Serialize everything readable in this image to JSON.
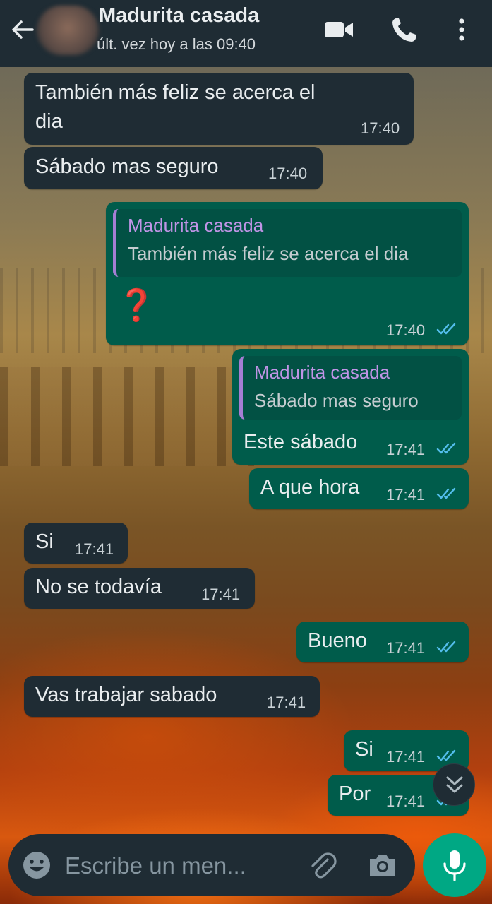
{
  "header": {
    "contact_name": "Madurita casada",
    "last_seen": "últ. vez hoy a las 09:40"
  },
  "messages": [
    {
      "direction": "in",
      "text_line1": "También más feliz se acerca el",
      "text_line2": "dia",
      "time": "17:40"
    },
    {
      "direction": "in",
      "text": "Sábado mas seguro",
      "time": "17:40"
    },
    {
      "direction": "out",
      "quote_name": "Madurita casada",
      "quote_text": "También más feliz se acerca el dia",
      "text": "❓",
      "time": "17:40",
      "status": "read"
    },
    {
      "direction": "out",
      "quote_name": "Madurita casada",
      "quote_text": "Sábado mas seguro",
      "text": "Este sábado",
      "time": "17:41",
      "status": "read"
    },
    {
      "direction": "out",
      "text": "A que hora",
      "time": "17:41",
      "status": "read"
    },
    {
      "direction": "in",
      "text": "Si",
      "time": "17:41"
    },
    {
      "direction": "in",
      "text": "No se todavía",
      "time": "17:41"
    },
    {
      "direction": "out",
      "text": "Bueno",
      "time": "17:41",
      "status": "read"
    },
    {
      "direction": "in",
      "text": "Vas trabajar sabado",
      "time": "17:41"
    },
    {
      "direction": "out",
      "text": "Si",
      "time": "17:41",
      "status": "read"
    },
    {
      "direction": "out",
      "text": "Por",
      "time": "17:41",
      "status": "read"
    }
  ],
  "composer": {
    "placeholder": "Escribe un men..."
  },
  "icons": {
    "back": "arrow-left-icon",
    "video": "video-call-icon",
    "call": "phone-icon",
    "menu": "more-vert-icon",
    "emoji": "emoji-icon",
    "attach": "paperclip-icon",
    "camera": "camera-icon",
    "mic": "mic-icon",
    "scroll": "double-chevron-down-icon"
  },
  "colors": {
    "header_bg": "#1f2c34",
    "incoming_bubble": "#1f2c34",
    "outgoing_bubble": "#005c4b",
    "read_ticks": "#53bdeb",
    "quote_name": "#c094e6",
    "mic_button": "#00a884"
  }
}
